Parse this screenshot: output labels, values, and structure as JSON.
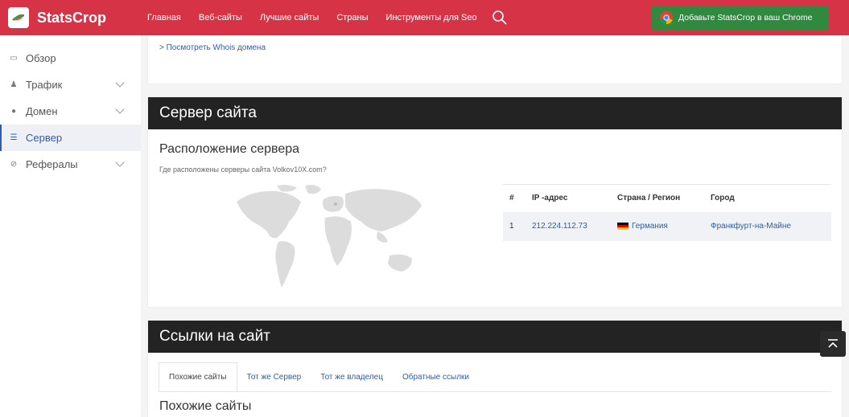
{
  "brand": {
    "name": "StatsCrop"
  },
  "nav": {
    "items": [
      "Главная",
      "Веб-сайты",
      "Лучшие сайты",
      "Страны",
      "Инструменты для Seo"
    ],
    "search_icon": "search-icon"
  },
  "chrome_button": {
    "label": "Добавьте StatsCrop в ваш Chrome",
    "color": "#2f8a3f"
  },
  "sidebar": {
    "items": [
      {
        "label": "Обзор",
        "icon": "monitor-icon",
        "expandable": false,
        "active": false
      },
      {
        "label": "Трафик",
        "icon": "users-icon",
        "expandable": true,
        "active": false
      },
      {
        "label": "Домен",
        "icon": "globe-icon",
        "expandable": true,
        "active": false
      },
      {
        "label": "Сервер",
        "icon": "server-icon",
        "expandable": false,
        "active": true
      },
      {
        "label": "Рефералы",
        "icon": "link-icon",
        "expandable": true,
        "active": false
      }
    ]
  },
  "whois": {
    "link": "> Посмотреть Whois домена"
  },
  "server_section": {
    "header": "Сервер сайта",
    "title": "Расположение сервера",
    "subtitle": "Где расположены серверы сайта Volkov10X.com?",
    "table": {
      "columns": [
        "#",
        "IP -адрес",
        "Страна / Регион",
        "Город"
      ],
      "rows": [
        {
          "num": "1",
          "ip": "212.224.112.73",
          "country": "Германия",
          "city": "Франкфурт-на-Майне"
        }
      ]
    }
  },
  "links_section": {
    "header": "Ссылки на сайт",
    "tabs": [
      "Похожие сайты",
      "Тот же Сервер",
      "Тот же владелец",
      "Обратные ссылки"
    ],
    "active_tab": 0,
    "subtitle": "Похожие сайты"
  },
  "colors": {
    "topbar": "#d63346",
    "accent": "#2c5fa8",
    "header_dark": "#232323"
  }
}
